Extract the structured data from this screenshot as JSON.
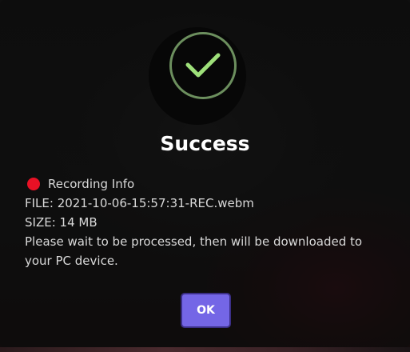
{
  "dialog": {
    "title": "Success",
    "icon": "check-circle-icon",
    "accent_color": "#6c8f5e",
    "info_heading": "Recording Info",
    "recording_indicator_color": "#e81125",
    "file_line": "FILE: 2021-10-06-15:57:31-REC.webm",
    "size_line": "SIZE: 14 MB",
    "message_line_1": "Please wait to be processed, then will be downloaded to",
    "message_line_2": "your PC device.",
    "ok_label": "OK",
    "ok_color": "#7466e6"
  }
}
